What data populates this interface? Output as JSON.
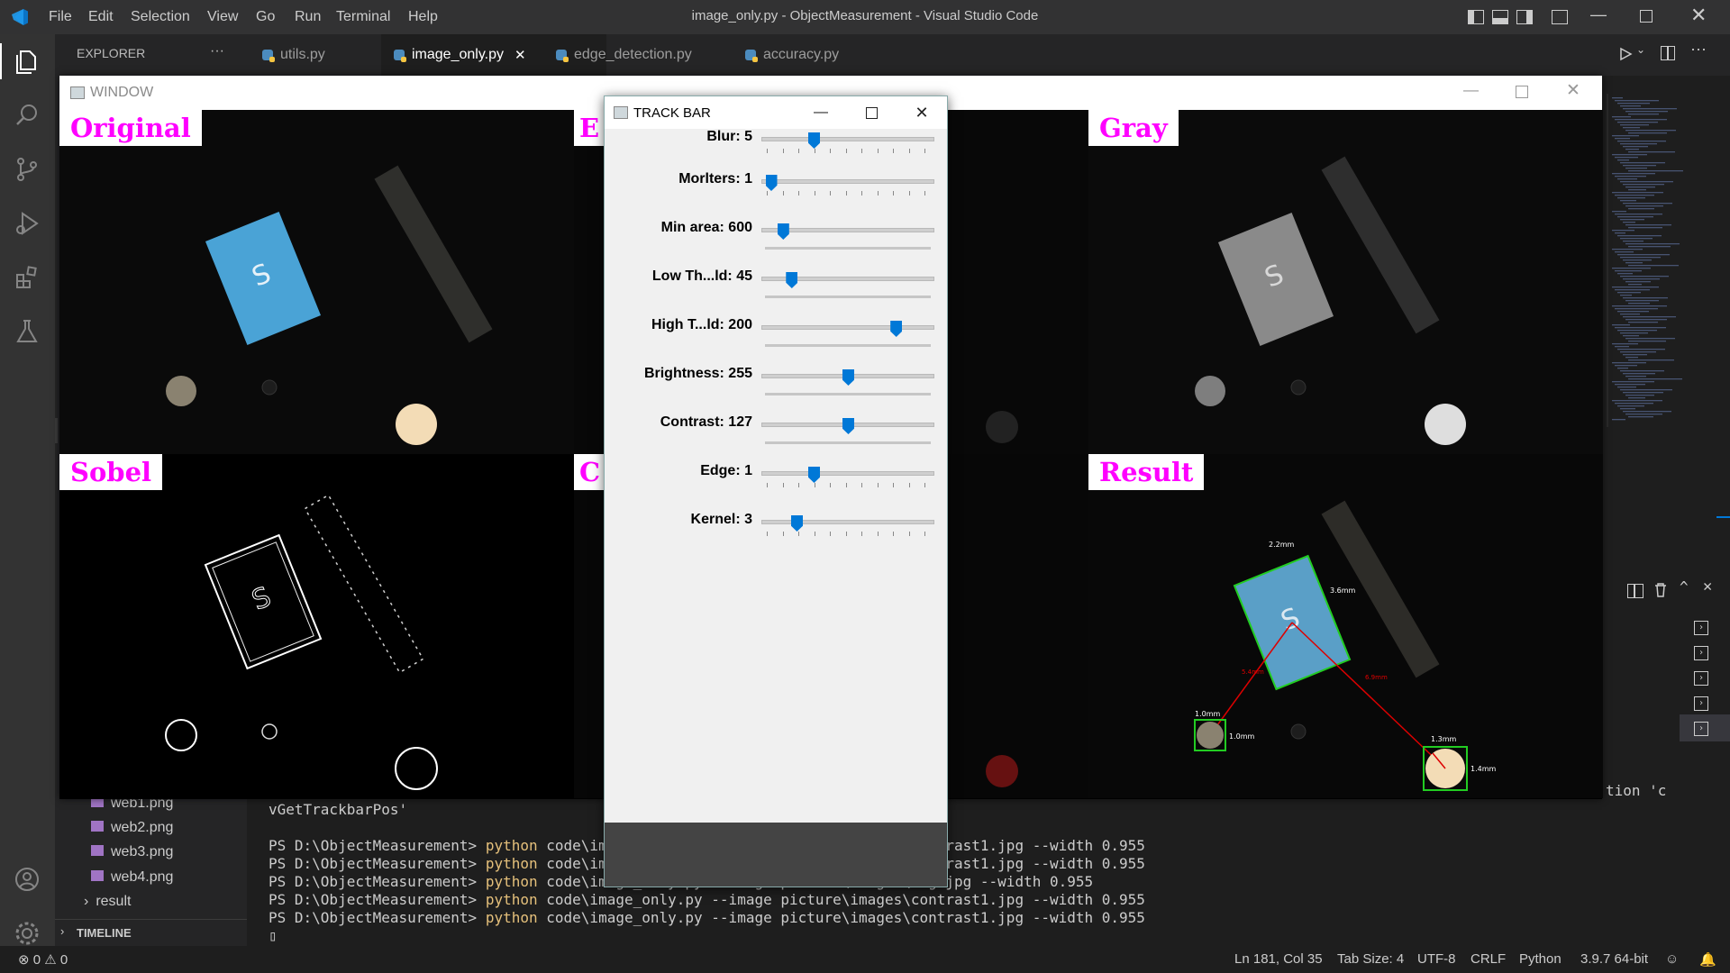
{
  "titlebar": {
    "menus": [
      "File",
      "Edit",
      "Selection",
      "View",
      "Go",
      "Run",
      "Terminal",
      "Help"
    ],
    "title": "image_only.py - ObjectMeasurement - Visual Studio Code"
  },
  "explorer": {
    "label": "EXPLORER",
    "more": "···"
  },
  "tabs": [
    {
      "label": "utils.py"
    },
    {
      "label": "image_only.py",
      "active": true,
      "close": "✕"
    },
    {
      "label": "edge_detection.py"
    },
    {
      "label": "accuracy.py"
    }
  ],
  "sidebar": {
    "files": [
      "web1.png",
      "web2.png",
      "web3.png",
      "web4.png"
    ],
    "folder": "result",
    "timeline": "TIMELINE"
  },
  "terminal": {
    "partial_top": "vGetTrackbarPos'",
    "partial_right": "tion 'c",
    "lines": [
      {
        "prompt": "PS D:\\ObjectMeasurement>",
        "cmd": "python",
        "args": "code\\image_only.py --image picture\\images\\contrast1.jpg --width 0.955"
      },
      {
        "prompt": "PS D:\\ObjectMeasurement>",
        "cmd": "python",
        "args": "code\\image_only.py --image picture\\images\\contrast1.jpg --width 0.955"
      },
      {
        "prompt": "PS D:\\ObjectMeasurement>",
        "cmd": "python",
        "args": "code\\image_only.py --image picture\\images\\org.jpg --width 0.955"
      },
      {
        "prompt": "PS D:\\ObjectMeasurement>",
        "cmd": "python",
        "args": "code\\image_only.py --image picture\\images\\contrast1.jpg --width 0.955"
      },
      {
        "prompt": "PS D:\\ObjectMeasurement>",
        "cmd": "python",
        "args": "code\\image_only.py --image picture\\images\\contrast1.jpg --width 0.955"
      }
    ],
    "cursor": "▯"
  },
  "image_window": {
    "title": "WINDOW",
    "quadrants": {
      "original": "Original",
      "edge_partial": "E",
      "gray": "Gray",
      "sobel": "Sobel",
      "contour_partial": "C",
      "result": "Result"
    },
    "measurements": [
      "2.2mm",
      "3.6mm",
      "1.0mm",
      "1.0mm",
      "1.3mm",
      "1.4mm",
      "6.9mm",
      "5.4mm"
    ]
  },
  "trackbar_window": {
    "title": "TRACK BAR",
    "sliders": [
      {
        "label": "Blur: 5",
        "fraction": 0.3
      },
      {
        "label": "Morlters: 1",
        "fraction": 0.05
      },
      {
        "label": "Min area: 600",
        "fraction": 0.12
      },
      {
        "label": "Low Th...ld: 45",
        "fraction": 0.17
      },
      {
        "label": "High T...ld: 200",
        "fraction": 0.78
      },
      {
        "label": "Brightness: 255",
        "fraction": 0.5
      },
      {
        "label": "Contrast: 127",
        "fraction": 0.5
      },
      {
        "label": "Edge: 1",
        "fraction": 0.3
      },
      {
        "label": "Kernel: 3",
        "fraction": 0.2
      }
    ]
  },
  "statusbar": {
    "problems": "⊗ 0 ⚠ 0",
    "position": "Ln 181, Col 35",
    "tabsize": "Tab Size: 4",
    "encoding": "UTF-8",
    "eol": "CRLF",
    "language": "Python",
    "interpreter": "3.9.7 64-bit"
  },
  "colors": {
    "accent": "#0078d7",
    "label_magenta": "#ff00ff",
    "measure_green": "#22cc22",
    "measure_red": "#dd0000"
  }
}
